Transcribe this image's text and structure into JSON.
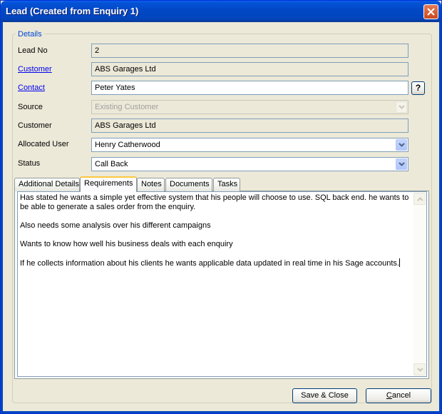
{
  "window": {
    "title": "Lead (Created from Enquiry 1)"
  },
  "details": {
    "legend": "Details",
    "lead_no": {
      "label": "Lead No",
      "value": "2"
    },
    "customer_link": {
      "label": "Customer",
      "value": "ABS Garages Ltd"
    },
    "contact": {
      "label": "Contact",
      "value": "Peter Yates",
      "help_label": "?"
    },
    "source": {
      "label": "Source",
      "value": "Existing Customer"
    },
    "customer": {
      "label": "Customer",
      "value": "ABS Garages Ltd"
    },
    "allocated_user": {
      "label": "Allocated User",
      "value": "Henry Catherwood"
    },
    "status": {
      "label": "Status",
      "value": "Call Back"
    }
  },
  "tabs": [
    {
      "label": "Additional Details"
    },
    {
      "label": "Requirements",
      "active": true
    },
    {
      "label": "Notes"
    },
    {
      "label": "Documents"
    },
    {
      "label": "Tasks"
    }
  ],
  "requirements": {
    "paragraphs": [
      "Has stated he wants a simple yet effective system that his people will choose to use. SQL back end. he wants to be able to generate a sales order from the enquiry.",
      "Also needs some analysis over his different campaigns",
      "Wants to know how well his business deals with each enquiry",
      "If he collects information about his clients he wants applicable data updated in real time in his Sage accounts."
    ]
  },
  "buttons": {
    "save_close": "Save & Close",
    "cancel_prefix": "C",
    "cancel_rest": "ancel"
  },
  "icons": {
    "close": "close-icon",
    "dropdown": "chevron-down-icon",
    "scroll_up": "scroll-up-arrow-icon",
    "scroll_down": "scroll-down-arrow-icon"
  },
  "colors": {
    "titlebar": "#0046bf",
    "link": "#0000ee",
    "legend": "#0046d5",
    "active_tab_accent": "#ffc83c"
  }
}
